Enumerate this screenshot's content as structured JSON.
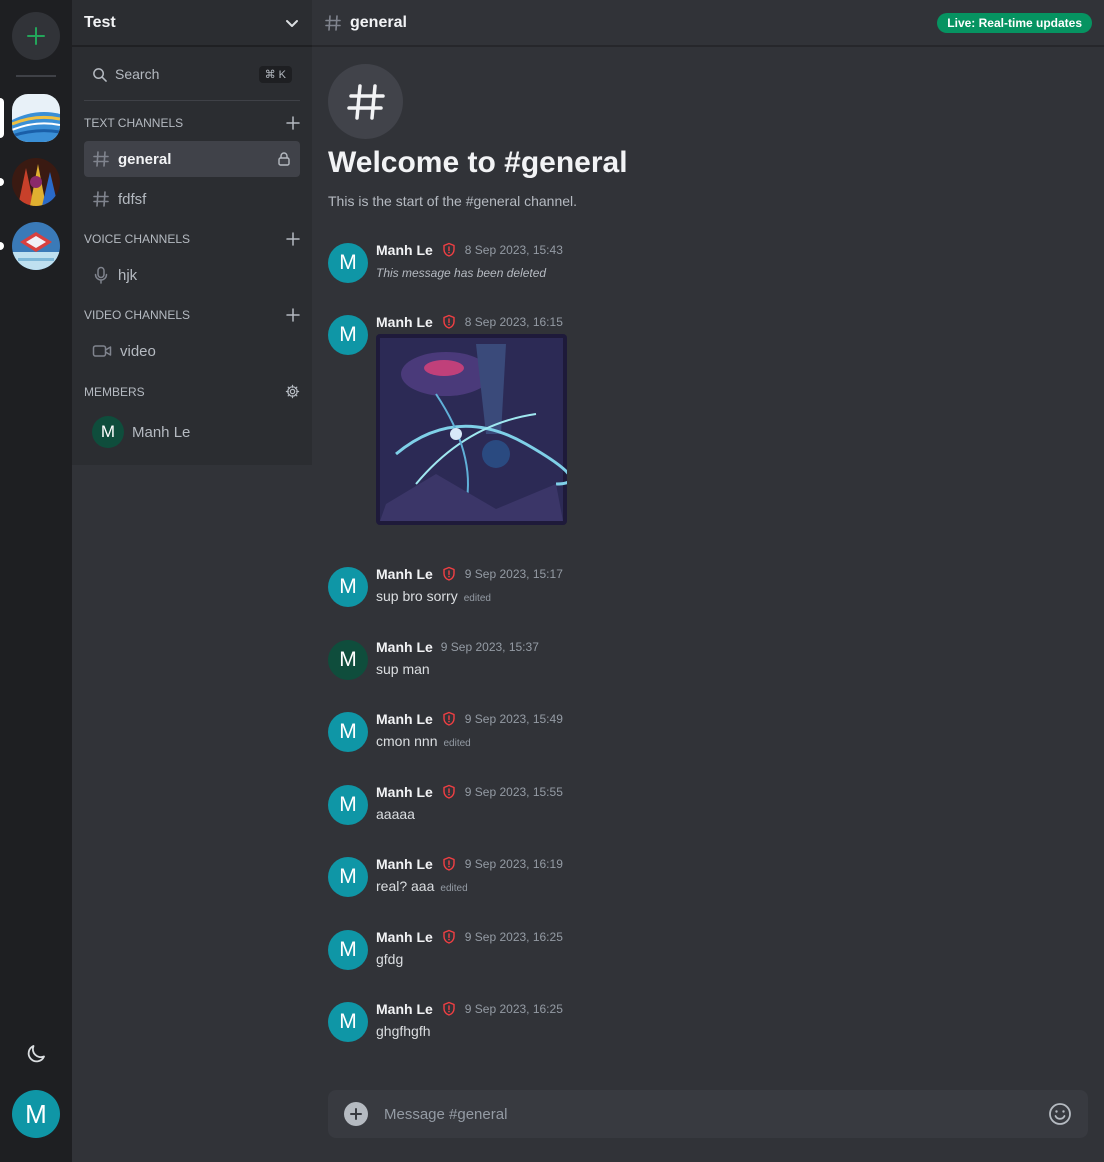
{
  "server": {
    "name": "Test",
    "search_label": "Search",
    "search_shortcut": "⌘ K",
    "sections": {
      "text": "TEXT CHANNELS",
      "voice": "VOICE CHANNELS",
      "video": "VIDEO CHANNELS",
      "members": "MEMBERS"
    },
    "text_channels": [
      "general",
      "fdfsf"
    ],
    "voice_channels": [
      "hjk"
    ],
    "video_channels": [
      "video"
    ],
    "members": [
      {
        "initial": "M",
        "name": "Manh Le"
      }
    ]
  },
  "user_avatar_initial": "M",
  "channel": {
    "name": "general",
    "live_badge": "Live: Real-time updates",
    "welcome_title": "Welcome to #general",
    "welcome_subtitle": "This is the start of the #general channel.",
    "composer_placeholder": "Message #general"
  },
  "messages": [
    {
      "initial": "M",
      "author": "Manh Le",
      "shield": true,
      "time": "8 Sep 2023, 15:43",
      "text": "This message has been deleted",
      "deleted": true
    },
    {
      "initial": "M",
      "author": "Manh Le",
      "shield": true,
      "time": "8 Sep 2023, 16:15",
      "image": true
    },
    {
      "initial": "M",
      "author": "Manh Le",
      "shield": true,
      "time": "9 Sep 2023, 15:17",
      "text": "sup bro sorry",
      "edited": "edited"
    },
    {
      "initial": "M",
      "author": "Manh Le",
      "shield": false,
      "time": "9 Sep 2023, 15:37",
      "text": "sup man"
    },
    {
      "initial": "M",
      "author": "Manh Le",
      "shield": true,
      "time": "9 Sep 2023, 15:49",
      "text": "cmon nnn",
      "edited": "edited"
    },
    {
      "initial": "M",
      "author": "Manh Le",
      "shield": true,
      "time": "9 Sep 2023, 15:55",
      "text": "aaaaa"
    },
    {
      "initial": "M",
      "author": "Manh Le",
      "shield": true,
      "time": "9 Sep 2023, 16:19",
      "text": "real? aaa",
      "edited": "edited"
    },
    {
      "initial": "M",
      "author": "Manh Le",
      "shield": true,
      "time": "9 Sep 2023, 16:25",
      "text": "gfdg"
    },
    {
      "initial": "M",
      "author": "Manh Le",
      "shield": true,
      "time": "9 Sep 2023, 16:25",
      "text": "ghgfhgfh"
    }
  ],
  "colors": {
    "accent": "#0f96a6",
    "live": "#069361",
    "moderator_shield": "#f23f43"
  }
}
